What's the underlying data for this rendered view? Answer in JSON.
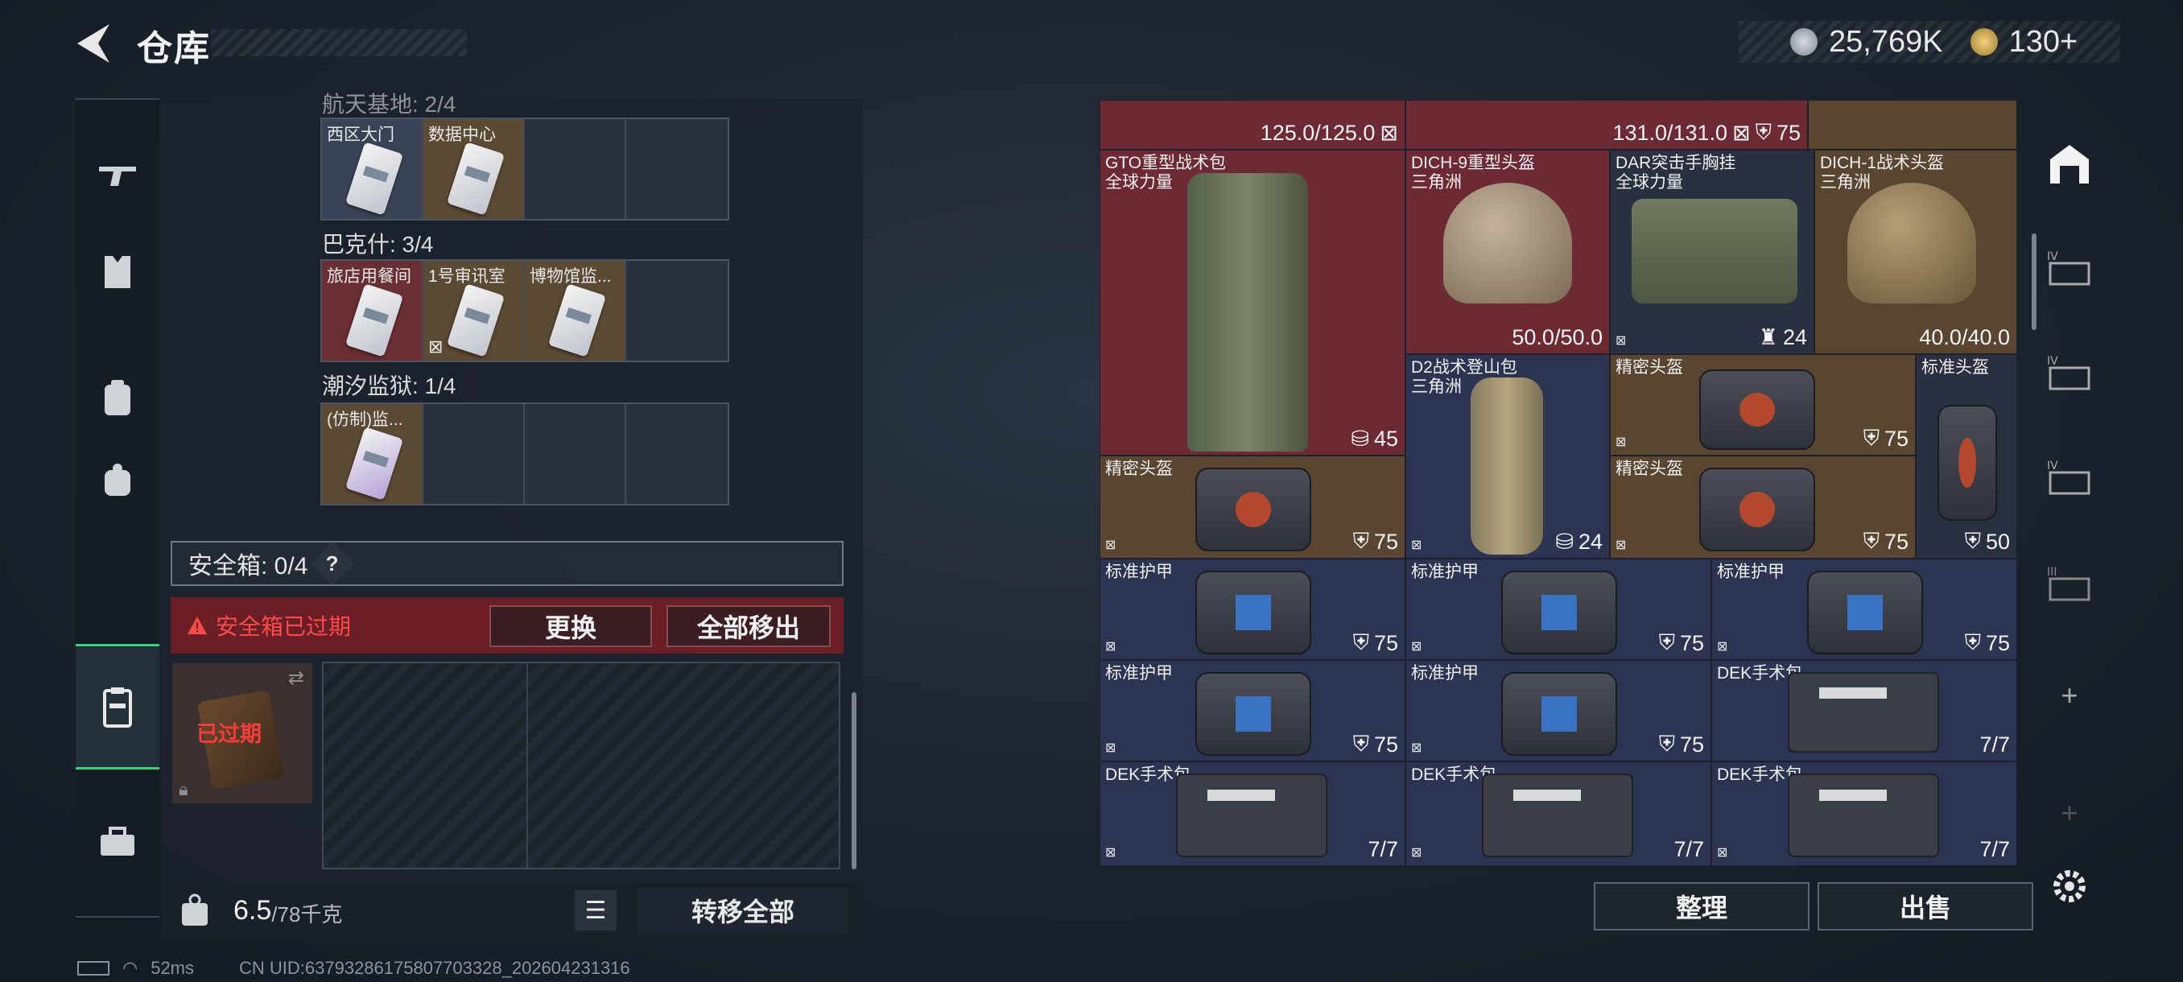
{
  "header": {
    "title": "仓库",
    "currency": [
      {
        "icon": "silver-coin-icon",
        "value": "25,769K"
      },
      {
        "icon": "gold-coin-icon",
        "value": "130+"
      }
    ]
  },
  "left_nav": [
    "gun-icon",
    "armor-vest-icon",
    "backpack-icon",
    "bag-icon",
    "safebox-icon",
    "toolbox-icon"
  ],
  "left_panel": {
    "top_cut_label": "航天基地: 2/4",
    "groups": [
      {
        "label": "",
        "slots": [
          {
            "label": "西区大门",
            "color": "blue"
          },
          {
            "label": "数据中心",
            "color": "gold"
          },
          {
            "label": "",
            "color": "empty"
          },
          {
            "label": "",
            "color": "empty"
          }
        ]
      },
      {
        "label": "巴克什: 3/4",
        "slots": [
          {
            "label": "旅店用餐间",
            "color": "red"
          },
          {
            "label": "1号审讯室",
            "color": "gold"
          },
          {
            "label": "博物馆监...",
            "color": "gold"
          },
          {
            "label": "",
            "color": "empty"
          }
        ]
      },
      {
        "label": "潮汐监狱: 1/4",
        "slots": [
          {
            "label": "(仿制)监...",
            "color": "gold"
          },
          {
            "label": "",
            "color": "empty"
          },
          {
            "label": "",
            "color": "empty"
          },
          {
            "label": "",
            "color": "empty"
          }
        ]
      }
    ],
    "safebox_label": "安全箱: 0/4",
    "safebox_help": "?",
    "expired_warning": "安全箱已过期",
    "replace_button": "更换",
    "move_all_out_button": "全部移出",
    "safebox_item_status": "已过期",
    "weight_value": "6.5",
    "weight_max": "/78千克",
    "transfer_all_button": "转移全部"
  },
  "right_panel": {
    "top_values": [
      "125.0/125.0",
      "131.0/131.0",
      "75"
    ],
    "items": [
      {
        "name": "GTO重型战术包\n全球力量",
        "value": "45",
        "value_icon": "capacity-icon"
      },
      {
        "name": "DICH-9重型头盔\n三角洲",
        "value": "50.0/50.0"
      },
      {
        "name": "DAR突击手胸挂\n全球力量",
        "value": "24",
        "value_icon": "vest-capacity-icon"
      },
      {
        "name": "DICH-1战术头盔\n三角洲",
        "value": "40.0/40.0"
      },
      {
        "name": "D2战术登山包\n三角洲",
        "value": "24",
        "value_icon": "capacity-icon"
      },
      {
        "name": "精密头盔",
        "value": "75"
      },
      {
        "name": "标准头盔",
        "value": "50"
      },
      {
        "name": "精密头盔",
        "value": "75"
      },
      {
        "name": "精密头盔",
        "value": "75"
      },
      {
        "name": "标准护甲",
        "value": "75"
      },
      {
        "name": "标准护甲",
        "value": "75"
      },
      {
        "name": "标准护甲",
        "value": "75"
      },
      {
        "name": "标准护甲",
        "value": "75"
      },
      {
        "name": "标准护甲",
        "value": "75"
      },
      {
        "name": "DEK手术包",
        "value": "7/7"
      },
      {
        "name": "DEK手术包",
        "value": "7/7"
      },
      {
        "name": "DEK手术包",
        "value": "7/7"
      },
      {
        "name": "DEK手术包",
        "value": "7/7"
      }
    ],
    "sort_button": "整理",
    "sell_button": "出售"
  },
  "right_nav": [
    "warehouse-icon",
    "warehouse-IV-icon",
    "warehouse-IV-icon",
    "warehouse-IV-icon",
    "warehouse-III-icon",
    "add-icon",
    "add-icon",
    "settings-icon"
  ],
  "status_bar": {
    "ping": "52ms",
    "uid": "CN UID:6379328617580770332​8_202604231316"
  }
}
